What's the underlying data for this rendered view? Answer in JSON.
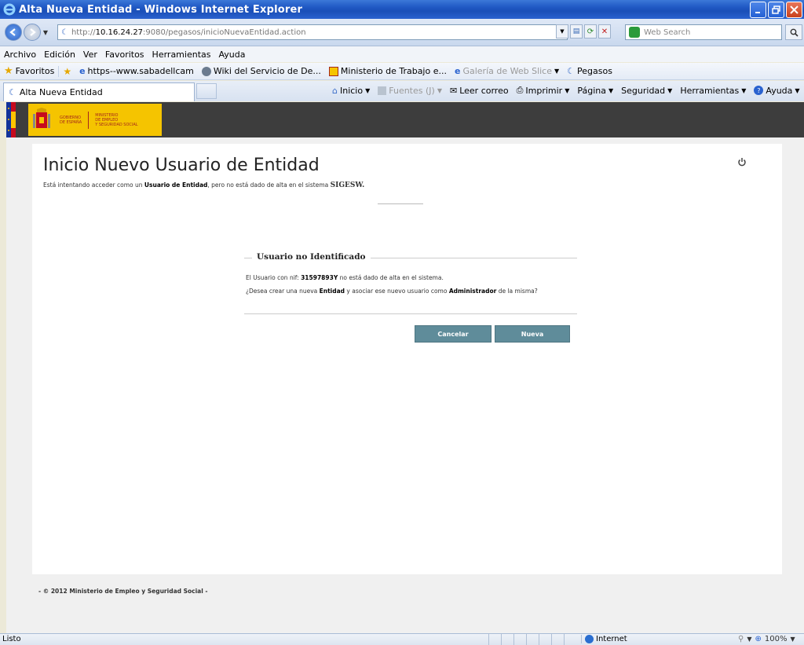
{
  "window": {
    "title": "Alta Nueva Entidad - Windows Internet Explorer"
  },
  "addressbar": {
    "url_prefix": "http://",
    "url_host": "10.16.24.27",
    "url_rest": ":9080/pegasos/inicioNuevaEntidad.action",
    "search_placeholder": "Web Search"
  },
  "menu": {
    "items": [
      "Archivo",
      "Edición",
      "Ver",
      "Favoritos",
      "Herramientas",
      "Ayuda"
    ]
  },
  "favorites": {
    "label": "Favoritos",
    "items": [
      {
        "label": "https--www.sabadellcam"
      },
      {
        "label": "Wiki del Servicio de De..."
      },
      {
        "label": "Ministerio de Trabajo e..."
      },
      {
        "label": "Galería de Web Slice"
      },
      {
        "label": "Pegasos"
      }
    ]
  },
  "tab": {
    "label": "Alta Nueva Entidad"
  },
  "commands": {
    "inicio": "Inicio",
    "fuentes": "Fuentes (J)",
    "leer_correo": "Leer correo",
    "imprimir": "Imprimir",
    "pagina": "Página",
    "seguridad": "Seguridad",
    "herramientas": "Herramientas",
    "ayuda": "Ayuda"
  },
  "header": {
    "logo_line1": "GOBIERNO",
    "logo_line2": "DE ESPAÑA",
    "logo_line3": "MINISTERIO",
    "logo_line4": "DE EMPLEO",
    "logo_line5": "Y SEGURIDAD SOCIAL"
  },
  "main": {
    "title": "Inicio Nuevo Usuario de Entidad",
    "desc_pre": "Está intentando acceder como un ",
    "desc_role": "Usuario de Entidad",
    "desc_mid": ", pero no está dado de alta en el sistema ",
    "desc_system": "SIGESW.",
    "panel": {
      "legend": "Usuario no Identificado",
      "line1_pre": "El Usuario con nif: ",
      "line1_nif": "31597893Y",
      "line1_post": " no está dado de alta en el sistema.",
      "line2_pre": "¿Desea crear una nueva ",
      "line2_entity": "Entidad",
      "line2_mid": " y asociar ese nuevo usuario como ",
      "line2_admin": "Administrador",
      "line2_post": " de la misma?"
    },
    "buttons": {
      "cancel": "Cancelar",
      "new": "Nueva"
    }
  },
  "footer": {
    "text": "- © 2012 Ministerio de Empleo y Seguridad Social -"
  },
  "status": {
    "text": "Listo",
    "zone": "Internet",
    "zoom": "100%"
  },
  "colors": {
    "titlebar": "#1f57c3",
    "button": "#5f8c9a",
    "header_bg": "#3d3d3d",
    "logo_bg": "#f5c400"
  }
}
